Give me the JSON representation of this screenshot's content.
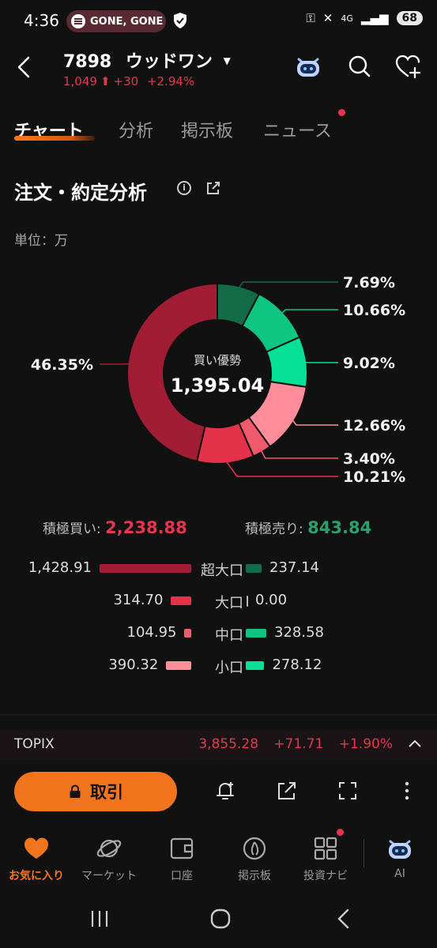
{
  "status_bar": {
    "time": "4:36",
    "media_text": "GONE, GONE",
    "battery": "68",
    "network": "4G"
  },
  "header": {
    "stock_code": "7898",
    "stock_name": "ウッドワン",
    "price": "1,049",
    "change": "+30",
    "change_pct": "+2.94%"
  },
  "tabs": [
    {
      "label": "チャート",
      "active": true
    },
    {
      "label": "分析",
      "active": false
    },
    {
      "label": "掲示板",
      "active": false
    },
    {
      "label": "ニュース",
      "active": false
    }
  ],
  "section": {
    "title": "注文・約定分析",
    "unit": "単位：万"
  },
  "chart_data": {
    "type": "pie",
    "center_label": "買い優勢",
    "center_value": "1,395.04",
    "slices": [
      {
        "label": "超大口 売り",
        "value": 7.69,
        "display": "7.69%",
        "color": "#136b48"
      },
      {
        "label": "中口 売り",
        "value": 10.66,
        "display": "10.66%",
        "color": "#0fc582"
      },
      {
        "label": "小口 売り",
        "value": 9.02,
        "display": "9.02%",
        "color": "#04e095"
      },
      {
        "label": "小口 買い",
        "value": 12.66,
        "display": "12.66%",
        "color": "#ff8d9a"
      },
      {
        "label": "中口 買い",
        "value": 3.4,
        "display": "3.40%",
        "color": "#f15a6c"
      },
      {
        "label": "大口 買い",
        "value": 10.21,
        "display": "10.21%",
        "color": "#e5324b"
      },
      {
        "label": "超大口 買い",
        "value": 46.35,
        "display": "46.35%",
        "color": "#a01d33"
      }
    ]
  },
  "totals": {
    "buy_label": "積極買い:",
    "buy_value": "2,238.88",
    "sell_label": "積極売り:",
    "sell_value": "843.84"
  },
  "breakdown": [
    {
      "label": "超大口",
      "buy": "1,428.91",
      "buy_num": 1428.91,
      "sell": "237.14",
      "sell_num": 237.14
    },
    {
      "label": "大口",
      "buy": "314.70",
      "buy_num": 314.7,
      "sell": "0.00",
      "sell_num": 0.0
    },
    {
      "label": "中口",
      "buy": "104.95",
      "buy_num": 104.95,
      "sell": "328.58",
      "sell_num": 328.58
    },
    {
      "label": "小口",
      "buy": "390.32",
      "buy_num": 390.32,
      "sell": "278.12",
      "sell_num": 278.12
    }
  ],
  "index_ticker": {
    "name": "TOPIX",
    "value": "3,855.28",
    "change": "+71.71",
    "change_pct": "+1.90%"
  },
  "actions": {
    "trade_label": "取引"
  },
  "bottom_nav": [
    {
      "label": "お気に入り",
      "icon": "heart-icon",
      "active": true
    },
    {
      "label": "マーケット",
      "icon": "planet-icon",
      "active": false
    },
    {
      "label": "口座",
      "icon": "wallet-icon",
      "active": false
    },
    {
      "label": "掲示板",
      "icon": "board-icon",
      "active": false
    },
    {
      "label": "投資ナビ",
      "icon": "grid-icon",
      "active": false
    },
    {
      "label": "AI",
      "icon": "robot-icon",
      "active": false
    }
  ],
  "colors": {
    "up": "#e8344e",
    "down_green": "#2aa06b",
    "accent": "#f2741c",
    "background": "#111111"
  }
}
